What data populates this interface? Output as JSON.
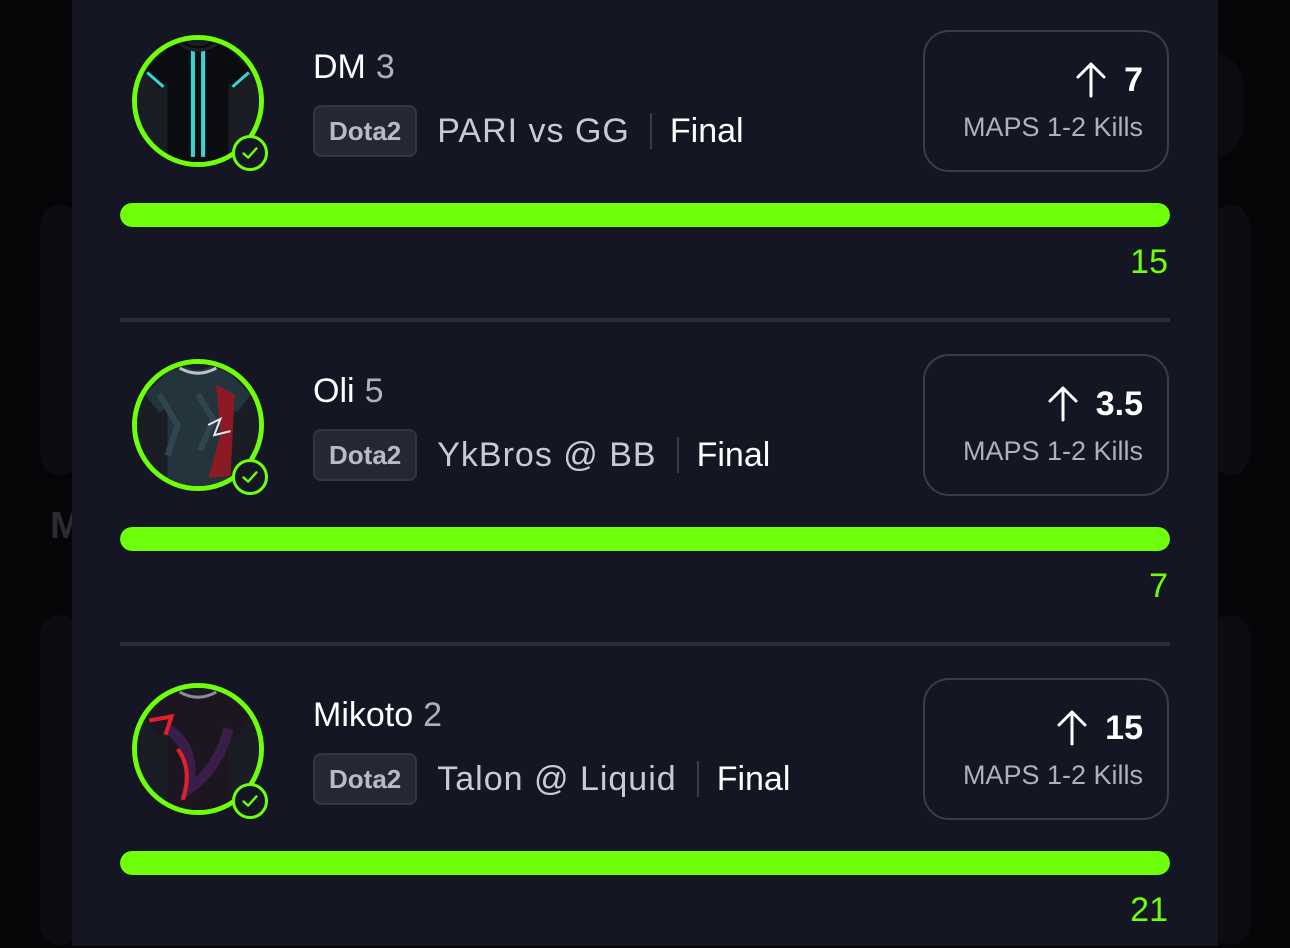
{
  "picks": [
    {
      "player": "DM",
      "position": "3",
      "game": "Dota2",
      "match": "PARI vs GG",
      "status": "Final",
      "direction": "more",
      "arrow_icon": "arrow-up-icon",
      "line": "7",
      "stat": "MAPS 1-2 Kills",
      "result": "15",
      "progress_percent": 100,
      "jersey": {
        "base": "#0b0c10",
        "accent": "#38d6d0",
        "stripe": "#1c1f26"
      }
    },
    {
      "player": "Oli",
      "position": "5",
      "game": "Dota2",
      "match": "YkBros @ BB",
      "status": "Final",
      "direction": "more",
      "arrow_icon": "arrow-up-icon",
      "line": "3.5",
      "stat": "MAPS 1-2 Kills",
      "result": "7",
      "progress_percent": 100,
      "jersey": {
        "base": "#23343c",
        "accent": "#8b1a25",
        "stripe": "#2f464f"
      }
    },
    {
      "player": "Mikoto",
      "position": "2",
      "game": "Dota2",
      "match": "Talon @ Liquid",
      "status": "Final",
      "direction": "more",
      "arrow_icon": "arrow-up-icon",
      "line": "15",
      "stat": "MAPS 1-2 Kills",
      "result": "21",
      "progress_percent": 100,
      "jersey": {
        "base": "#1b1620",
        "accent": "#e0202c",
        "stripe": "#3a1e4a"
      }
    }
  ],
  "colors": {
    "accent": "#6eff0b",
    "sheet_bg": "#141723"
  }
}
